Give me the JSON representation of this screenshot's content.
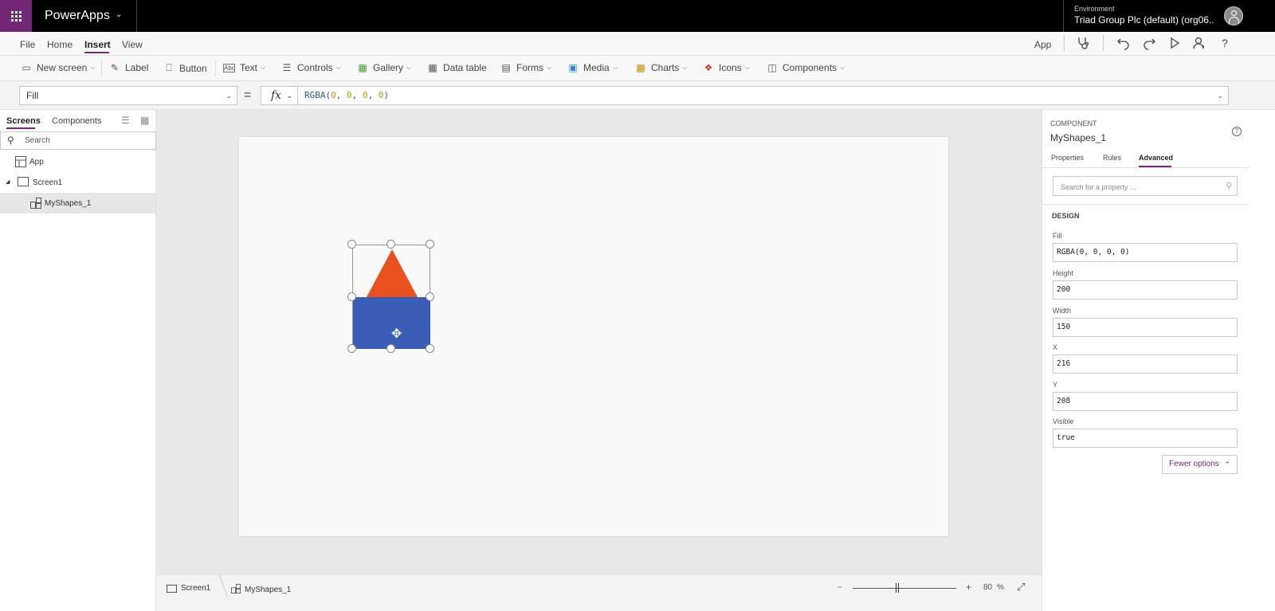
{
  "topbar": {
    "app_name": "PowerApps",
    "environment_label": "Environment",
    "environment_value": "Triad Group Plc (default) (org06..."
  },
  "menu": {
    "tabs": [
      {
        "label": "File"
      },
      {
        "label": "Home"
      },
      {
        "label": "Insert",
        "active": true
      },
      {
        "label": "View"
      }
    ],
    "right_label": "App"
  },
  "toolbar": {
    "items": [
      {
        "label": "New screen",
        "icon": "new-screen-icon",
        "dropdown": true
      },
      {
        "label": "Label",
        "icon": "label-icon"
      },
      {
        "label": "Button",
        "icon": "button-icon"
      },
      {
        "label": "Text",
        "icon": "text-input-icon",
        "dropdown": true
      },
      {
        "label": "Controls",
        "icon": "controls-icon",
        "dropdown": true
      },
      {
        "label": "Gallery",
        "icon": "gallery-icon",
        "dropdown": true
      },
      {
        "label": "Data table",
        "icon": "data-table-icon"
      },
      {
        "label": "Forms",
        "icon": "forms-icon",
        "dropdown": true
      },
      {
        "label": "Media",
        "icon": "media-icon",
        "dropdown": true
      },
      {
        "label": "Charts",
        "icon": "charts-icon",
        "dropdown": true
      },
      {
        "label": "Icons",
        "icon": "icons-icon",
        "dropdown": true
      },
      {
        "label": "Components",
        "icon": "components-icon",
        "dropdown": true
      }
    ]
  },
  "formula": {
    "property": "Fill",
    "equals": "=",
    "fx": "fx",
    "func": "RGBA(",
    "args": [
      "0",
      "0",
      "0",
      "0"
    ],
    "close": ")"
  },
  "left_panel": {
    "tabs": [
      {
        "label": "Screens",
        "active": true
      },
      {
        "label": "Components"
      }
    ],
    "search_placeholder": "Search",
    "tree": [
      {
        "label": "App"
      },
      {
        "label": "Screen1"
      },
      {
        "label": "MyShapes_1",
        "selected": true
      }
    ]
  },
  "canvas": {
    "triangle_color": "#e8501d",
    "rect_color": "#3a5db5"
  },
  "bottom": {
    "crumbs": [
      {
        "label": "Screen1"
      },
      {
        "label": "MyShapes_1"
      }
    ],
    "zoom_minus": "−",
    "zoom_plus": "+",
    "zoom_value": "80",
    "zoom_unit": "%",
    "zoom_level": 0.43
  },
  "right_panel": {
    "kicker": "COMPONENT",
    "title": "MyShapes_1",
    "tabs": [
      {
        "label": "Properties"
      },
      {
        "label": "Rules"
      },
      {
        "label": "Advanced",
        "active": true
      }
    ],
    "search_placeholder": "Search for a property ...",
    "section": "DESIGN",
    "fields": [
      {
        "label": "Fill",
        "value": "RGBA(0, 0, 0, 0)"
      },
      {
        "label": "Height",
        "value": "200"
      },
      {
        "label": "Width",
        "value": "150"
      },
      {
        "label": "X",
        "value": "216"
      },
      {
        "label": "Y",
        "value": "208"
      },
      {
        "label": "Visible",
        "value": "true"
      }
    ],
    "fewer_options": "Fewer options"
  },
  "colors": {
    "brand": "#742774",
    "formula_func": "#2b579a",
    "formula_num": "#c19c00"
  }
}
